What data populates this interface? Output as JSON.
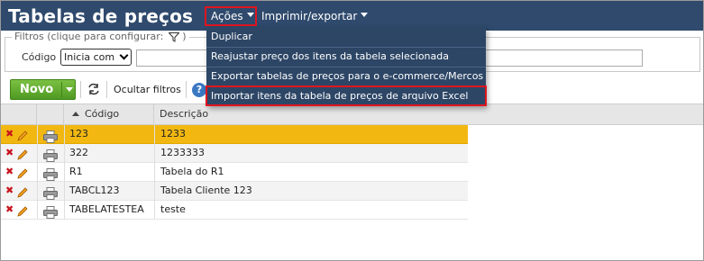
{
  "header": {
    "title": "Tabelas de preços",
    "menu_acoes": "Ações",
    "menu_imprimir": "Imprimir/exportar"
  },
  "filters": {
    "legend": "Filtros (clique para configurar:",
    "legend_close": ")",
    "codigo_label": "Código",
    "codigo_select_value": "Inicia com",
    "search_value": ""
  },
  "toolbar": {
    "novo_label": "Novo",
    "ocultar_label": "Ocultar filtros",
    "help_label": "?"
  },
  "grid": {
    "headers": [
      "Código",
      "Descrição"
    ],
    "rows": [
      {
        "codigo": "123",
        "descricao": "1233"
      },
      {
        "codigo": "322",
        "descricao": "1233333"
      },
      {
        "codigo": "R1",
        "descricao": "Tabela do R1"
      },
      {
        "codigo": "TABCL123",
        "descricao": "Tabela Cliente 123"
      },
      {
        "codigo": "TABELATESTEA",
        "descricao": "teste"
      }
    ]
  },
  "acoes_menu": {
    "items": [
      "Duplicar",
      "Reajustar preço dos itens da tabela selecionada",
      "Exportar tabelas de preços para o e-commerce/Mercos",
      "Importar itens da tabela de preços de arquivo Excel"
    ]
  },
  "colors": {
    "header_bg": "#2f4a6d",
    "menu_bg": "#2d4666",
    "highlight_outline": "#e0151e",
    "selected_row": "#f2b811",
    "novo_green": "#5fa82e"
  },
  "icons": {
    "delete": "close-x-icon",
    "edit": "pencil-icon",
    "print": "printer-icon",
    "refresh": "refresh-icon",
    "filter": "funnel-icon",
    "help": "help-icon"
  }
}
